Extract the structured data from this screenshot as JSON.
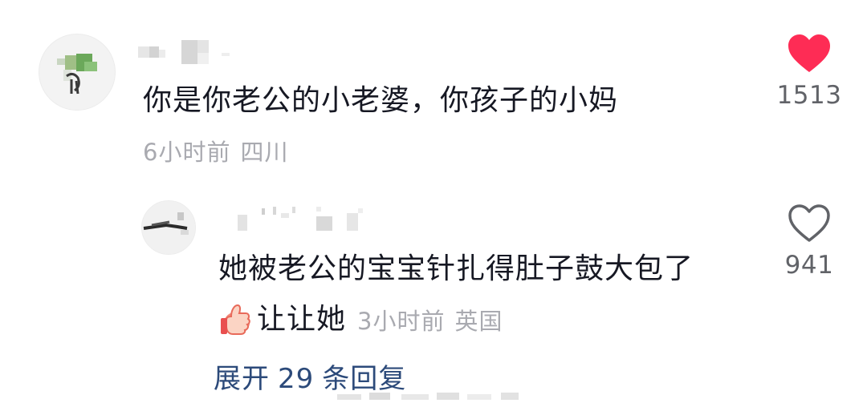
{
  "comments": [
    {
      "text": "你是你老公的小老婆，你孩子的小妈",
      "time": "6小时前",
      "location": "四川",
      "likes": "1513",
      "liked": true,
      "colors": {
        "heart_liked": "#fe2c55"
      },
      "reply": {
        "text": "她被老公的宝宝针扎得肚子鼓大包了",
        "emoji_icon": "thumbs-up-emoji",
        "suffix": "让让她",
        "time": "3小时前",
        "location": "英国",
        "likes": "941",
        "liked": false
      }
    }
  ],
  "expand": {
    "prefix": "展开",
    "count": "29",
    "suffix": "条回复"
  },
  "colors": {
    "text": "#161823",
    "meta": "#a9aab0",
    "link": "#2c4a7a",
    "heart": "#fe2c55"
  }
}
